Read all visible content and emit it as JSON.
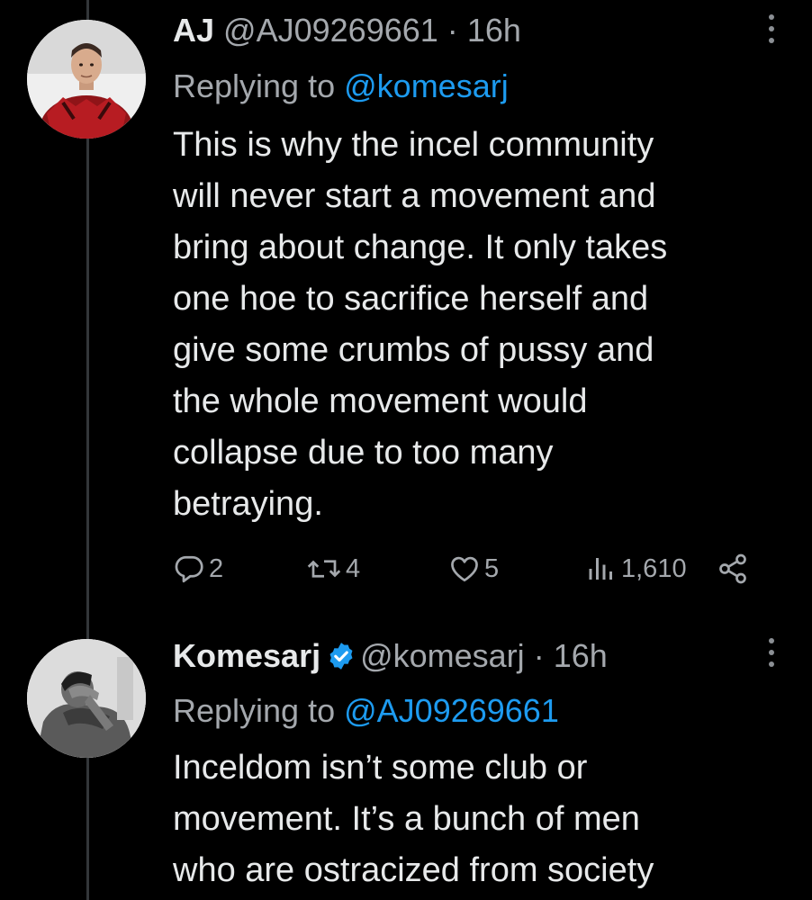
{
  "colors": {
    "background": "#000000",
    "text_primary": "#e7e9ea",
    "text_secondary": "#a4a8ad",
    "link": "#1d9bf0",
    "thread_line": "#333639",
    "verified_badge": "#1d9bf0"
  },
  "tweets": [
    {
      "display_name": "AJ",
      "handle": "@AJ09269661",
      "separator": "·",
      "time": "16h",
      "verified": false,
      "avatar_icon": "avatar-man-red-armor",
      "replying_to_label": "Replying to",
      "replying_to_handle": "@komesarj",
      "body_lines": [
        "This is why the incel community",
        "will never start a movement and",
        "bring about change. It only takes",
        "one hoe to sacrifice herself and",
        "give some crumbs of pussy and",
        "the whole movement would",
        "collapse due to too many",
        "betraying."
      ],
      "actions": {
        "reply_count": "2",
        "retweet_count": "4",
        "like_count": "5",
        "view_count": "1,610"
      }
    },
    {
      "display_name": "Komesarj",
      "handle": "@komesarj",
      "separator": "·",
      "time": "16h",
      "verified": true,
      "avatar_icon": "avatar-man-head-in-hand",
      "replying_to_label": "Replying to",
      "replying_to_handle": "@AJ09269661",
      "body_lines": [
        "Inceldom isn’t some club or",
        "movement. It’s a bunch of men",
        "who are ostracized from society"
      ]
    }
  ]
}
